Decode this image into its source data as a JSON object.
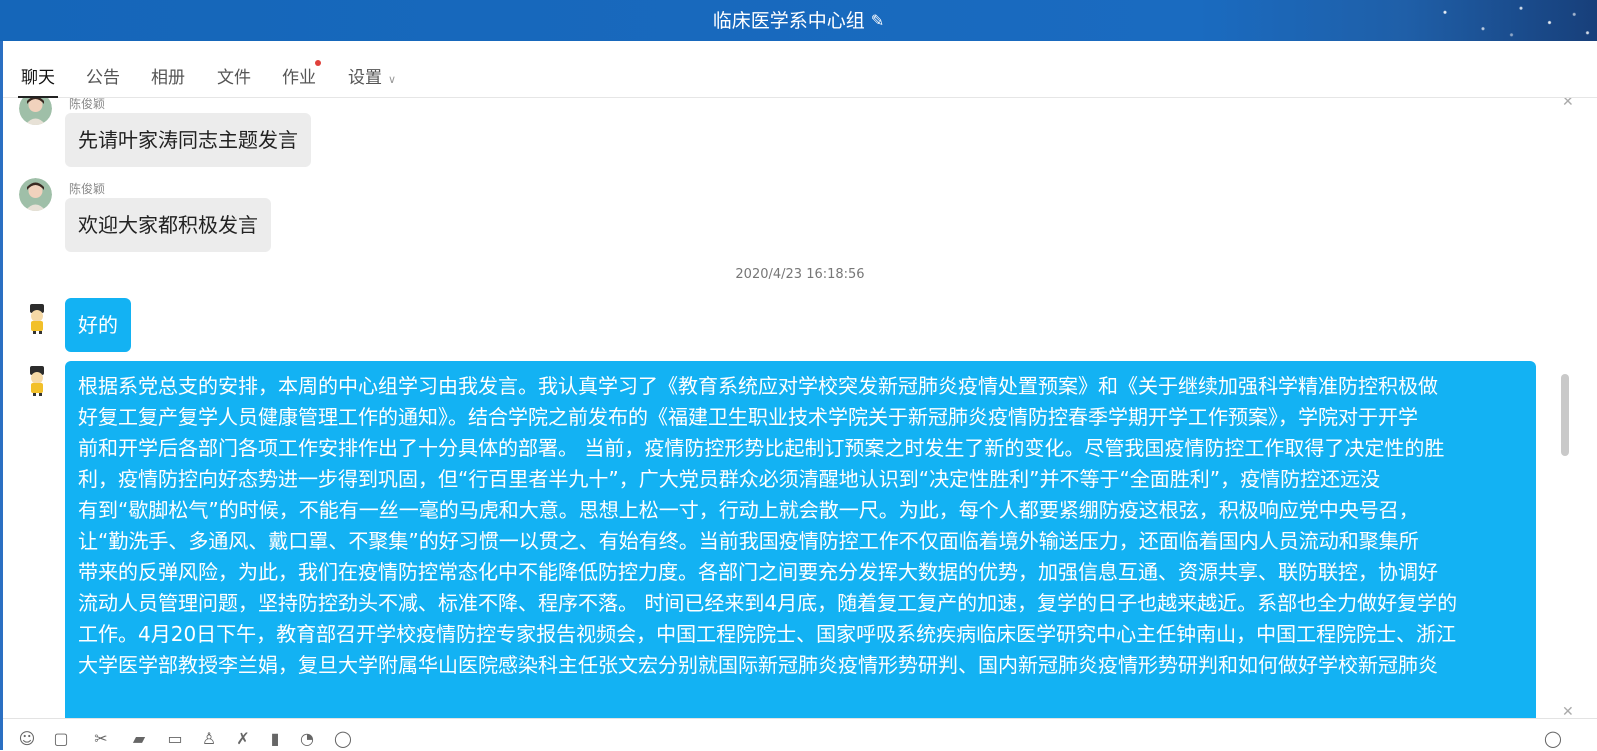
{
  "window": {
    "title": "临床医学系中心组"
  },
  "tabs": [
    {
      "label": "聊天",
      "active": true
    },
    {
      "label": "公告"
    },
    {
      "label": "相册"
    },
    {
      "label": "文件"
    },
    {
      "label": "作业",
      "badge": true
    },
    {
      "label": "设置"
    }
  ],
  "messages": [
    {
      "sender": "陈俊颖",
      "text": "先请叶家涛同志主题发言"
    },
    {
      "sender": "陈俊颖",
      "text": "欢迎大家都积极发言"
    },
    {
      "timestamp": "2020/4/23 16:18:56"
    },
    {
      "text": "好的"
    },
    {
      "lines": [
        "根据系党总支的安排，本周的中心组学习由我发言。我认真学习了《教育系统应对学校突发新冠肺炎疫情处置预案》和《关于继续加强科学精准防控积极做",
        "好复工复产复学人员健康管理工作的通知》。结合学院之前发布的《福建卫生职业技术学院关于新冠肺炎疫情防控春季学期开学工作预案》，学院对于开学",
        "前和开学后各部门各项工作安排作出了十分具体的部署。 当前，疫情防控形势比起制订预案之时发生了新的变化。尽管我国疫情防控工作取得了决定性的胜",
        "利，疫情防控向好态势进一步得到巩固，但“行百里者半九十”，广大党员群众必须清醒地认识到“决定性胜利”并不等于“全面胜利”，疫情防控还远没",
        "有到“歇脚松气”的时候，不能有一丝一毫的马虎和大意。思想上松一寸，行动上就会散一尺。为此，每个人都要紧绷防疫这根弦，积极响应党中央号召，",
        "让“勤洗手、多通风、戴口罩、不聚集”的好习惯一以贯之、有始有终。当前我国疫情防控工作不仅面临着境外输送压力，还面临着国内人员流动和聚集所",
        "带来的反弹风险，为此，我们在疫情防控常态化中不能降低防控力度。各部门之间要充分发挥大数据的优势，加强信息互通、资源共享、联防联控，协调好",
        "流动人员管理问题，坚持防控劲头不减、标准不降、程序不落。 时间已经来到4月底，随着复工复产的加速，复学的日子也越来越近。系部也全力做好复学的",
        "工作。4月20日下午，教育部召开学校疫情防控专家报告视频会，中国工程院院士、国家呼吸系统疾病临床医学研究中心主任钟南山，中国工程院院士、浙江",
        "大学医学部教授李兰娟，复旦大学附属华山医院感染科主任张文宏分别就国际新冠肺炎疫情形势研判、国内新冠肺炎疫情形势研判和如何做好学校新冠肺炎"
      ]
    }
  ],
  "colors": {
    "title_bar": "#1566b9",
    "self_bubble": "#13b2f3",
    "other_bubble": "#ececec",
    "badge": "#e0403a"
  }
}
